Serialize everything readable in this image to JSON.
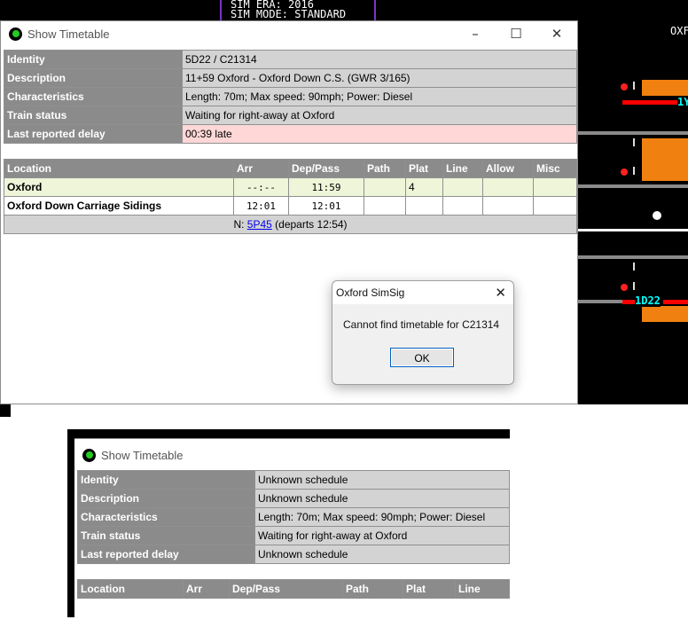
{
  "sim_banner": {
    "line1": "SIM ERA: 2016",
    "line2": "SIM MODE: STANDARD"
  },
  "sim_labels": {
    "top_right": "OXF",
    "headcode_a": "1Y",
    "headcode_b": "1D22"
  },
  "window1": {
    "title": "Show Timetable",
    "details": [
      {
        "label": "Identity",
        "value": "5D22 / C21314"
      },
      {
        "label": "Description",
        "value": "11+59 Oxford - Oxford Down C.S. (GWR 3/165)"
      },
      {
        "label": "Characteristics",
        "value": "Length: 70m; Max speed: 90mph; Power: Diesel"
      },
      {
        "label": "Train status",
        "value": "Waiting for right-away at Oxford"
      },
      {
        "label": "Last reported delay",
        "value": "00:39 late"
      }
    ],
    "columns": [
      "Location",
      "Arr",
      "Dep/Pass",
      "Path",
      "Plat",
      "Line",
      "Allow",
      "Misc"
    ],
    "rows": [
      {
        "location": "Oxford",
        "arr": "--:--",
        "dep": "11:59",
        "path": "",
        "plat": "4",
        "line": "",
        "allow": "",
        "misc": ""
      },
      {
        "location": "Oxford Down Carriage Sidings",
        "arr": "12:01",
        "dep": "12:01",
        "path": "",
        "plat": "",
        "line": "",
        "allow": "",
        "misc": ""
      }
    ],
    "next": {
      "prefix": "N: ",
      "link": "5P45",
      "suffix": " (departs 12:54)"
    }
  },
  "dialog": {
    "title": "Oxford SimSig",
    "message": "Cannot find timetable for C21314",
    "ok": "OK"
  },
  "window2": {
    "title": "Show Timetable",
    "details": [
      {
        "label": "Identity",
        "value": "Unknown schedule"
      },
      {
        "label": "Description",
        "value": "Unknown schedule"
      },
      {
        "label": "Characteristics",
        "value": "Length: 70m; Max speed: 90mph; Power: Diesel"
      },
      {
        "label": "Train status",
        "value": "Waiting for right-away at Oxford"
      },
      {
        "label": "Last reported delay",
        "value": "Unknown schedule"
      }
    ],
    "columns": [
      "Location",
      "Arr",
      "Dep/Pass",
      "Path",
      "Plat",
      "Line"
    ]
  },
  "colors": {
    "header": "#8b8b8b",
    "value": "#d3d3d3",
    "delay": "#ffd7d7",
    "current_row": "#eef5d8",
    "track_red": "#ff0000",
    "block_orange": "#f08010"
  }
}
